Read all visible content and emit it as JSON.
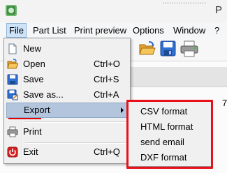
{
  "window": {
    "title_fragment": "P",
    "title_partial": "...................",
    "background_char": "7"
  },
  "menubar": {
    "items": [
      "File",
      "Part List",
      "Print preview",
      "Options",
      "Window",
      "?"
    ]
  },
  "toolbar": {
    "icons": [
      "open-folder-icon",
      "floppy-save-icon",
      "printer-icon"
    ]
  },
  "file_menu": {
    "items": [
      {
        "label": "New",
        "shortcut": "",
        "icon": "new-document-icon"
      },
      {
        "label": "Open",
        "shortcut": "Ctrl+O",
        "icon": "open-folder-icon"
      },
      {
        "label": "Save",
        "shortcut": "Ctrl+S",
        "icon": "floppy-save-icon"
      },
      {
        "label": "Save as...",
        "shortcut": "Ctrl+A",
        "icon": "save-as-icon"
      },
      {
        "label": "Export",
        "shortcut": "",
        "icon": ""
      },
      {
        "label": "Print",
        "shortcut": "",
        "icon": "printer-icon"
      },
      {
        "label": "Exit",
        "shortcut": "Ctrl+Q",
        "icon": "power-icon"
      }
    ]
  },
  "export_submenu": {
    "items": [
      "CSV format",
      "HTML format",
      "send email",
      "DXF format"
    ]
  },
  "colors": {
    "highlight_box": "#e8101a",
    "menu_hover": "#b3c5dc",
    "menubar_active": "#cde3f7"
  }
}
